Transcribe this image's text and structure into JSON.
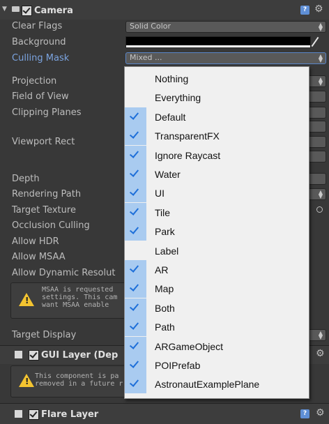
{
  "camera": {
    "title": "Camera",
    "rows": [
      {
        "label": "Clear Flags",
        "value": "Solid Color"
      },
      {
        "label": "Background",
        "value": ""
      },
      {
        "label": "Culling Mask",
        "value": "Mixed ..."
      },
      {
        "label": "Projection",
        "value": ""
      },
      {
        "label": "Field of View",
        "value": ""
      },
      {
        "label": "Clipping Planes",
        "value": ""
      },
      {
        "label": "Viewport Rect",
        "value": ""
      },
      {
        "label": "Depth",
        "value": ""
      },
      {
        "label": "Rendering Path",
        "value": ""
      },
      {
        "label": "Target Texture",
        "value": ""
      },
      {
        "label": "Occlusion Culling",
        "value": ""
      },
      {
        "label": "Allow HDR",
        "value": ""
      },
      {
        "label": "Allow MSAA",
        "value": ""
      },
      {
        "label": "Allow Dynamic Resolut",
        "value": ""
      },
      {
        "label": "Target Display",
        "value": ""
      }
    ],
    "warning": "MSAA is requested\nsettings. This cam\nwant MSAA enable"
  },
  "gui_layer": {
    "title": "GUI Layer (Dep",
    "warning": "This component is pa\nremoved in a future r"
  },
  "flare_layer": {
    "title": "Flare Layer"
  },
  "dropdown": {
    "items": [
      {
        "label": "Nothing",
        "checked": false
      },
      {
        "label": "Everything",
        "checked": false
      },
      {
        "label": "Default",
        "checked": true
      },
      {
        "label": "TransparentFX",
        "checked": true
      },
      {
        "label": "Ignore Raycast",
        "checked": true
      },
      {
        "label": "Water",
        "checked": true
      },
      {
        "label": "UI",
        "checked": true
      },
      {
        "label": "Tile",
        "checked": true
      },
      {
        "label": "Park",
        "checked": true
      },
      {
        "label": "Label",
        "checked": false
      },
      {
        "label": "AR",
        "checked": true
      },
      {
        "label": "Map",
        "checked": true
      },
      {
        "label": "Both",
        "checked": true
      },
      {
        "label": "Path",
        "checked": true
      },
      {
        "label": "ARGameObject",
        "checked": true
      },
      {
        "label": "POIPrefab",
        "checked": true
      },
      {
        "label": "AstronautExamplePlane",
        "checked": true
      }
    ]
  },
  "icons": {
    "help": "help-icon",
    "gear": "gear-icon",
    "camera": "camera-icon",
    "warning": "warning-icon",
    "eyedropper": "eyedropper-icon"
  },
  "colors": {
    "check_strip": "#a9cbf0",
    "checkmark": "#1e6fd9",
    "highlight_label": "#7ba4e0",
    "warning": "#f4c430"
  }
}
